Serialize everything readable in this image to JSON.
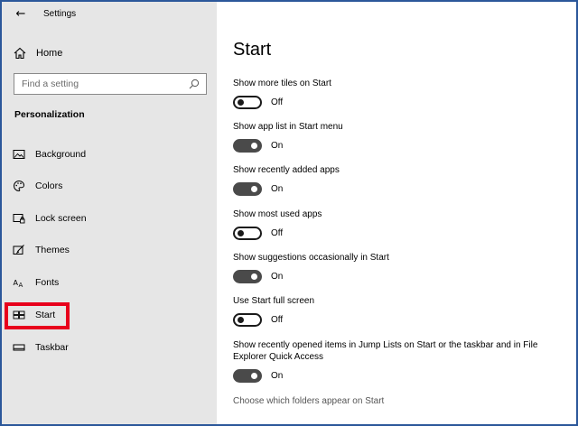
{
  "window": {
    "title": "Settings"
  },
  "sidebar": {
    "home_label": "Home",
    "search_placeholder": "Find a setting",
    "section_title": "Personalization",
    "items": [
      {
        "label": "Background",
        "icon": "picture-icon"
      },
      {
        "label": "Colors",
        "icon": "palette-icon"
      },
      {
        "label": "Lock screen",
        "icon": "lock-screen-icon"
      },
      {
        "label": "Themes",
        "icon": "themes-icon"
      },
      {
        "label": "Fonts",
        "icon": "fonts-icon"
      },
      {
        "label": "Start",
        "icon": "start-icon",
        "selected": true
      },
      {
        "label": "Taskbar",
        "icon": "taskbar-icon"
      }
    ],
    "highlight_color": "#e8001c"
  },
  "main": {
    "title": "Start",
    "settings": [
      {
        "label": "Show more tiles on Start",
        "state": "Off"
      },
      {
        "label": "Show app list in Start menu",
        "state": "On"
      },
      {
        "label": "Show recently added apps",
        "state": "On"
      },
      {
        "label": "Show most used apps",
        "state": "Off"
      },
      {
        "label": "Show suggestions occasionally in Start",
        "state": "On"
      },
      {
        "label": "Use Start full screen",
        "state": "Off"
      },
      {
        "label": "Show recently opened items in Jump Lists on Start or the taskbar and in File Explorer Quick Access",
        "state": "On"
      }
    ],
    "link": "Choose which folders appear on Start"
  },
  "colors": {
    "window_border": "#2b579a",
    "sidebar_bg": "#e6e6e6",
    "toggle_on": "#4a4a4a"
  }
}
